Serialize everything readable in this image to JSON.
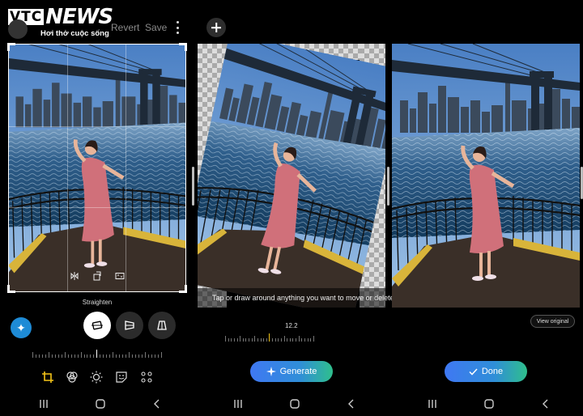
{
  "watermark": {
    "brand_box": "VTC",
    "brand_news": "NEWS",
    "slogan": "Hơi thở cuộc sống"
  },
  "editor_topbar": {
    "revert_label": "Revert",
    "save_label": "Save"
  },
  "straighten_panel": {
    "section_label": "Straighten",
    "modes": [
      "straighten-icon",
      "vertical-perspective-icon",
      "horizontal-perspective-icon"
    ],
    "active_mode": "straighten"
  },
  "bottom_tools": [
    "crop-icon",
    "filters-icon",
    "brightness-icon",
    "sticker-icon",
    "more-tools-icon"
  ],
  "generative_panel": {
    "hint": "Tap or draw around anything you want to move or delete.",
    "angle_value": "12.2",
    "generate_label": "Generate"
  },
  "result_panel": {
    "view_original_label": "View original",
    "done_label": "Done"
  },
  "colors": {
    "accent_blue": "#3f78f3",
    "accent_green": "#2fbf8c",
    "background": "#000000"
  }
}
